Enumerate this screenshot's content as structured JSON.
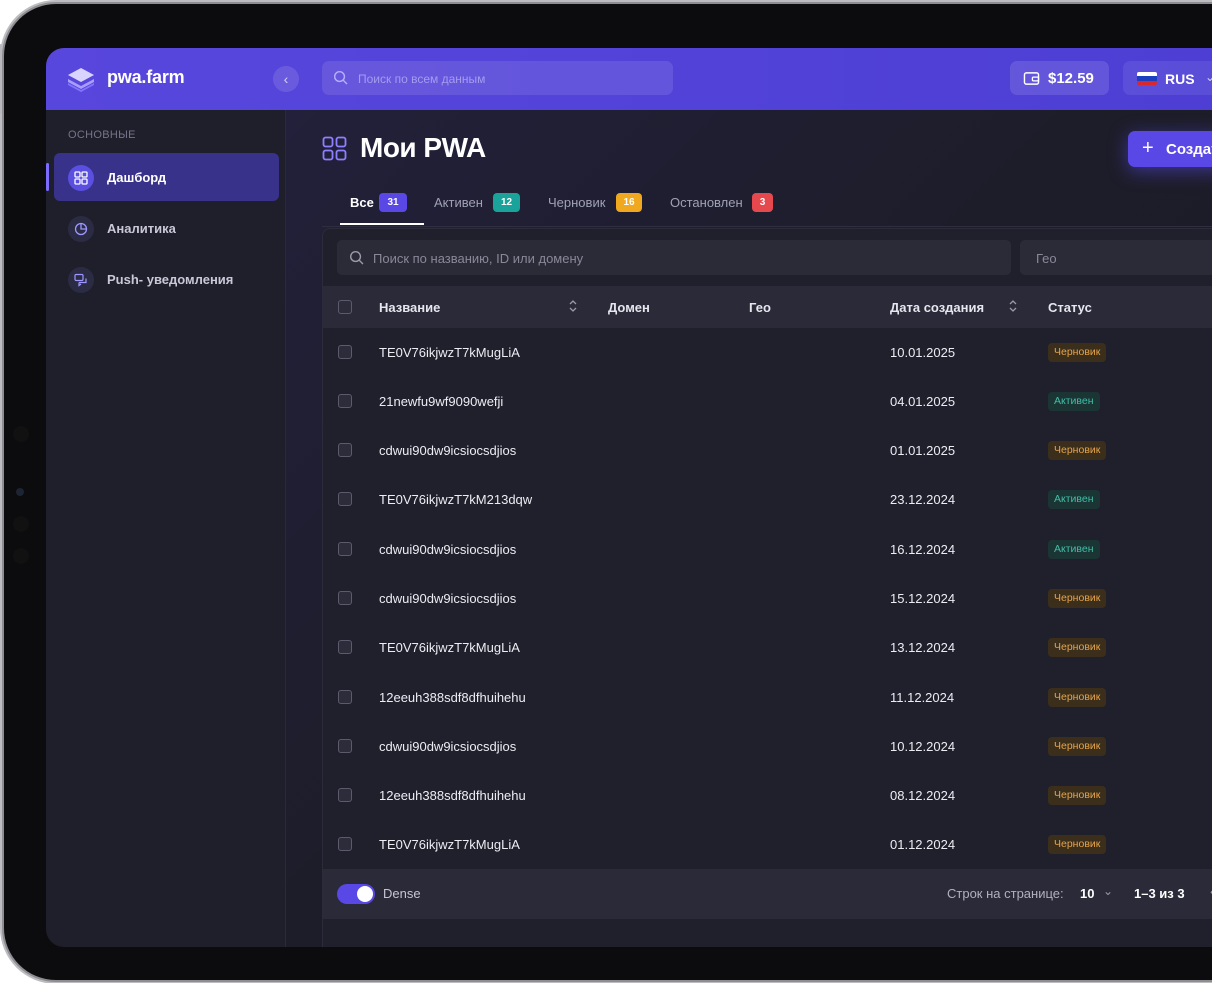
{
  "app": {
    "brand": "pwa.farm"
  },
  "header": {
    "search_placeholder": "Поиск по всем данным",
    "balance": "$12.59",
    "language": "RUS"
  },
  "sidebar": {
    "section_label": "ОСНОВНЫЕ",
    "items": [
      {
        "label": "Дашборд",
        "icon": "dashboard-icon",
        "active": true
      },
      {
        "label": "Аналитика",
        "icon": "analytics-icon",
        "active": false
      },
      {
        "label": "Push- уведомления",
        "icon": "push-notification-icon",
        "active": false
      }
    ]
  },
  "main": {
    "title": "Мои PWA",
    "create_label": "Создат",
    "tabs": [
      {
        "label": "Все",
        "count": "31",
        "color": "#5a48e6",
        "active": true
      },
      {
        "label": "Активен",
        "count": "12",
        "color": "#1aa39a",
        "active": false
      },
      {
        "label": "Черновик",
        "count": "16",
        "color": "#f0a81e",
        "active": false
      },
      {
        "label": "Остановлен",
        "count": "3",
        "color": "#e5484d",
        "active": false
      }
    ],
    "table_search_placeholder": "Поиск по названию, ID или домену",
    "geo_placeholder": "Гео",
    "columns": [
      "Название",
      "Домен",
      "Гео",
      "Дата создания",
      "Статус"
    ],
    "rows": [
      {
        "name": "TE0V76ikjwzT7kMugLiA",
        "date": "10.01.2025",
        "status": "Черновик",
        "kind": "draft"
      },
      {
        "name": "21newfu9wf9090wefji",
        "date": "04.01.2025",
        "status": "Активен",
        "kind": "active"
      },
      {
        "name": "cdwui90dw9icsiocsdjios",
        "date": "01.01.2025",
        "status": "Черновик",
        "kind": "draft"
      },
      {
        "name": "TE0V76ikjwzT7kM213dqw",
        "date": "23.12.2024",
        "status": "Активен",
        "kind": "active"
      },
      {
        "name": "cdwui90dw9icsiocsdjios",
        "date": "16.12.2024",
        "status": "Активен",
        "kind": "active"
      },
      {
        "name": "cdwui90dw9icsiocsdjios",
        "date": "15.12.2024",
        "status": "Черновик",
        "kind": "draft"
      },
      {
        "name": "TE0V76ikjwzT7kMugLiA",
        "date": "13.12.2024",
        "status": "Черновик",
        "kind": "draft"
      },
      {
        "name": "12eeuh388sdf8dfhuihehu",
        "date": "11.12.2024",
        "status": "Черновик",
        "kind": "draft"
      },
      {
        "name": "cdwui90dw9icsiocsdjios",
        "date": "10.12.2024",
        "status": "Черновик",
        "kind": "draft"
      },
      {
        "name": "12eeuh388sdf8dfhuihehu",
        "date": "08.12.2024",
        "status": "Черновик",
        "kind": "draft"
      },
      {
        "name": "TE0V76ikjwzT7kMugLiA",
        "date": "01.12.2024",
        "status": "Черновик",
        "kind": "draft"
      }
    ],
    "footer": {
      "dense_label": "Dense",
      "rows_per_page_label": "Строк на странице:",
      "rows_per_page": "10",
      "range": "1–3 из 3"
    }
  }
}
